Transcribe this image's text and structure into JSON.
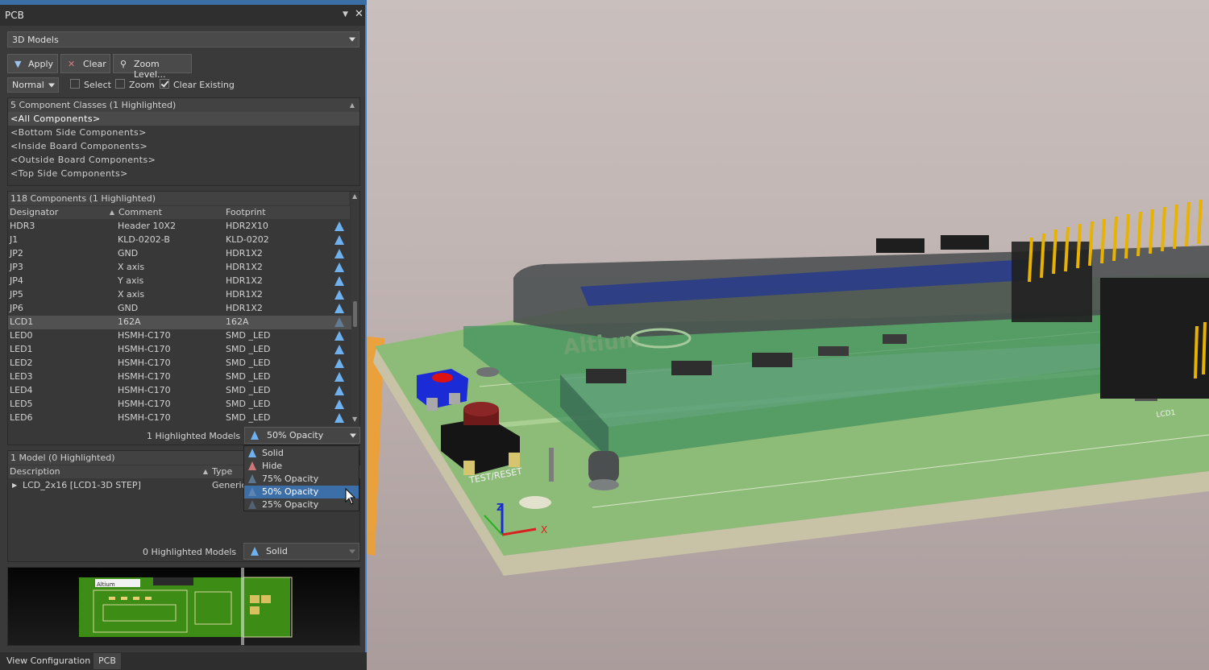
{
  "panel": {
    "title": "PCB",
    "mode": "3D Models",
    "buttons": {
      "apply": "Apply",
      "clear": "Clear",
      "zoom_level": "Zoom Level..."
    },
    "filter_mode": "Normal",
    "options": [
      {
        "label": "Select",
        "checked": false
      },
      {
        "label": "Zoom",
        "checked": false
      },
      {
        "label": "Clear Existing",
        "checked": true
      }
    ]
  },
  "classes": {
    "header": "5 Component Classes (1 Highlighted)",
    "items": [
      "<All Components>",
      "<Bottom Side Components>",
      "<Inside Board Components>",
      "<Outside Board Components>",
      "<Top Side Components>"
    ],
    "selected_index": 0
  },
  "components": {
    "header": "118 Components (1 Highlighted)",
    "columns": [
      "Designator",
      "Comment",
      "Footprint"
    ],
    "rows": [
      {
        "designator": "HDR3",
        "comment": "Header 10X2",
        "footprint": "HDR2X10"
      },
      {
        "designator": "J1",
        "comment": "KLD-0202-B",
        "footprint": "KLD-0202"
      },
      {
        "designator": "JP2",
        "comment": "GND",
        "footprint": "HDR1X2"
      },
      {
        "designator": "JP3",
        "comment": "X axis",
        "footprint": "HDR1X2"
      },
      {
        "designator": "JP4",
        "comment": "Y axis",
        "footprint": "HDR1X2"
      },
      {
        "designator": "JP5",
        "comment": "X axis",
        "footprint": "HDR1X2"
      },
      {
        "designator": "JP6",
        "comment": "GND",
        "footprint": "HDR1X2"
      },
      {
        "designator": "LCD1",
        "comment": "162A",
        "footprint": "162A"
      },
      {
        "designator": "LED0",
        "comment": "HSMH-C170",
        "footprint": "SMD _LED"
      },
      {
        "designator": "LED1",
        "comment": "HSMH-C170",
        "footprint": "SMD _LED"
      },
      {
        "designator": "LED2",
        "comment": "HSMH-C170",
        "footprint": "SMD _LED"
      },
      {
        "designator": "LED3",
        "comment": "HSMH-C170",
        "footprint": "SMD _LED"
      },
      {
        "designator": "LED4",
        "comment": "HSMH-C170",
        "footprint": "SMD _LED"
      },
      {
        "designator": "LED5",
        "comment": "HSMH-C170",
        "footprint": "SMD _LED"
      },
      {
        "designator": "LED6",
        "comment": "HSMH-C170",
        "footprint": "SMD _LED"
      }
    ],
    "selected_index": 7,
    "highlighted_label": "1 Highlighted Models",
    "opacity_value": "50% Opacity"
  },
  "opacity_menu": {
    "items": [
      "Solid",
      "Hide",
      "75% Opacity",
      "50% Opacity",
      "25% Opacity"
    ],
    "selected_index": 3
  },
  "models": {
    "header": "1 Model (0 Highlighted)",
    "columns": [
      "Description",
      "Type"
    ],
    "rows": [
      {
        "description": "LCD_2x16 [LCD1-3D STEP]",
        "type": "Generic"
      }
    ],
    "highlighted_label": "0 Highlighted Models",
    "opacity_value": "Solid"
  },
  "tabs": [
    "View Configuration",
    "PCB"
  ],
  "active_tab_index": 1,
  "viewport": {
    "silkscreen_texts": [
      "TEST/RESET",
      "LCD1"
    ],
    "logo_text": "Altium",
    "axes": [
      "Z",
      "X"
    ]
  }
}
